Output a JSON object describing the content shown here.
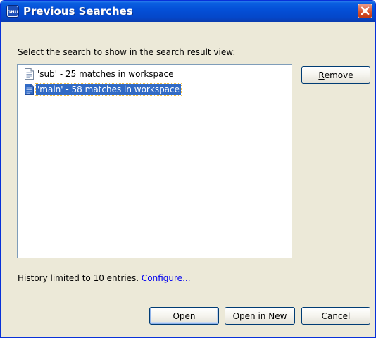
{
  "window": {
    "title": "Previous Searches",
    "app_icon": "gnu-icon",
    "close_icon": "close-icon"
  },
  "instruction": {
    "mnemonic": "S",
    "rest": "elect the search to show in the search result view:"
  },
  "searches": [
    {
      "label": "'sub' - 25 matches in workspace",
      "icon": "document-icon",
      "selected": false
    },
    {
      "label": "'main' - 58 matches in workspace",
      "icon": "document-icon",
      "selected": true
    }
  ],
  "buttons": {
    "remove": {
      "mnemonic": "R",
      "rest": "emove"
    },
    "open": {
      "mnemonic": "O",
      "rest": "pen"
    },
    "open_in_new": {
      "pre": "Open in ",
      "mnemonic": "N",
      "rest": "ew"
    },
    "cancel": {
      "label": "Cancel"
    }
  },
  "history": {
    "text": "History limited to 10 entries.",
    "link": "Configure..."
  },
  "colors": {
    "titlebar": "#0450d8",
    "selection": "#316ac5",
    "dialog_bg": "#ece9d8",
    "link": "#0000ee"
  }
}
